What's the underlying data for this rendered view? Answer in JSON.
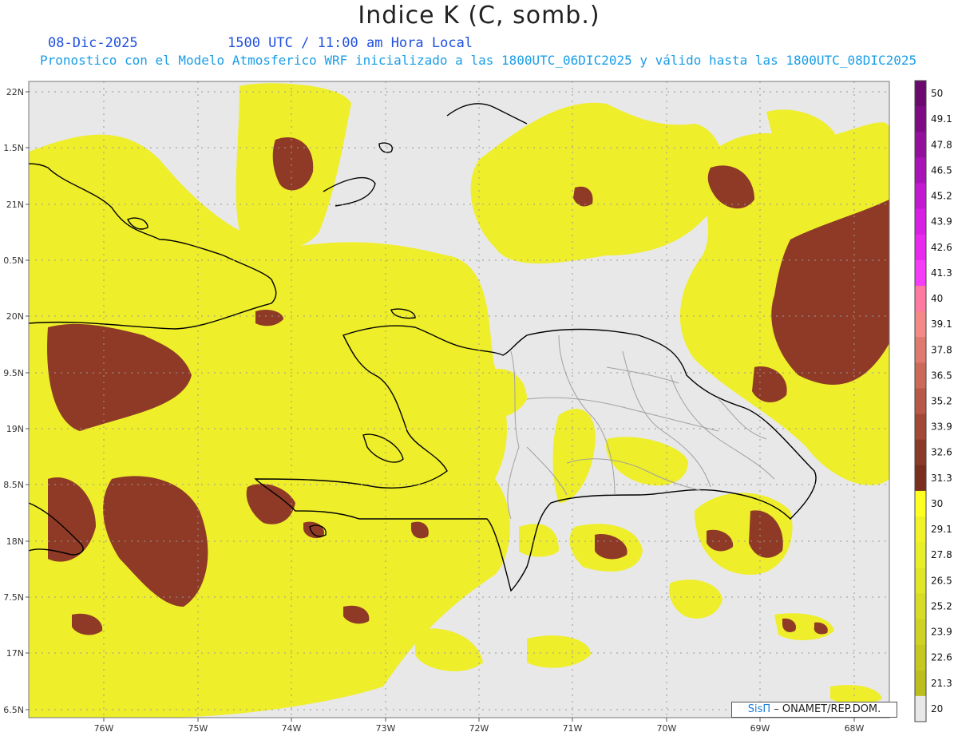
{
  "title": "Indice K (C, somb.)",
  "date": "08-Dic-2025",
  "time": "1500 UTC / 11:00 am Hora Local",
  "forecast_note": "Pronostico con el Modelo Atmosferico WRF inicializado a las 1800UTC_06DIC2025 y válido hasta las  1800UTC_08DIC2025",
  "credit": {
    "brand": "SisΠ",
    "org": "– ONAMET/REP.DOM."
  },
  "lat_labels": [
    "22N",
    "1.5N",
    "21N",
    "0.5N",
    "20N",
    "9.5N",
    "19N",
    "8.5N",
    "18N",
    "7.5N",
    "17N",
    "6.5N"
  ],
  "lon_labels": [
    "76W",
    "75W",
    "74W",
    "73W",
    "72W",
    "71W",
    "70W",
    "69W",
    "68W"
  ],
  "colorbar": {
    "labels": [
      "50",
      "49.1",
      "47.8",
      "46.5",
      "45.2",
      "43.9",
      "42.6",
      "41.3",
      "40",
      "39.1",
      "37.8",
      "36.5",
      "35.2",
      "33.9",
      "32.6",
      "31.3",
      "30",
      "29.1",
      "27.8",
      "26.5",
      "25.2",
      "23.9",
      "22.6",
      "21.3",
      "20"
    ],
    "colors": [
      "#6a0a6e",
      "#7d0c84",
      "#92109c",
      "#a814b6",
      "#c21ad0",
      "#d81fe4",
      "#e92aee",
      "#f53cf6",
      "#ff7aa0",
      "#f48a88",
      "#e07a6e",
      "#cc6a5a",
      "#b85848",
      "#a24836",
      "#8c3a28",
      "#7a2e1e",
      "#ffff22",
      "#f2f228",
      "#e8ee28",
      "#e0e628",
      "#d8dc26",
      "#cfd224",
      "#c6c822",
      "#bcbe20",
      "#e8e8e8"
    ]
  },
  "legend_colors": {
    "below_20": "#e8e8e8",
    "yellow": "#eeee2a",
    "brown": "#8e3a26",
    "coast": "#000000",
    "borders": "#a0a0a0"
  }
}
